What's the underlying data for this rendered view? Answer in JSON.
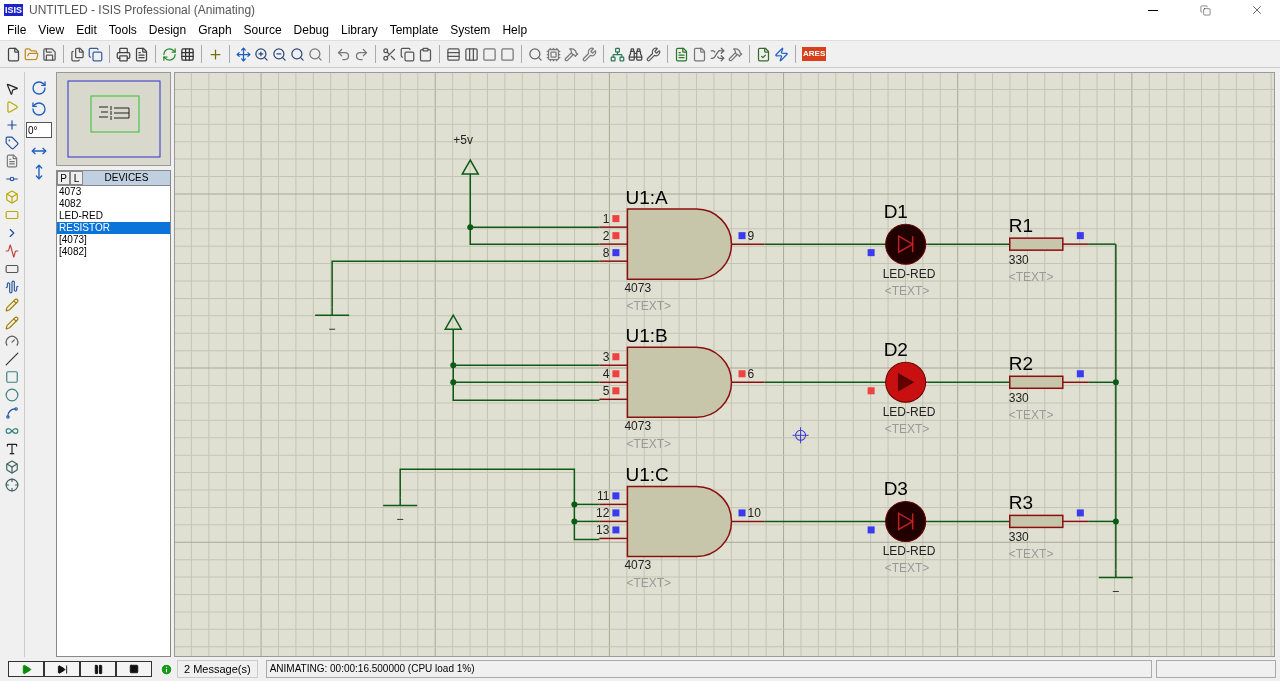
{
  "window": {
    "logo": "ISIS",
    "title": "UNTITLED - ISIS Professional (Animating)"
  },
  "menu": [
    "File",
    "View",
    "Edit",
    "Tools",
    "Design",
    "Graph",
    "Source",
    "Debug",
    "Library",
    "Template",
    "System",
    "Help"
  ],
  "toolbar": {
    "ares_label": "ARES"
  },
  "rotation": {
    "value": "0°"
  },
  "devices": {
    "tabs": [
      "P",
      "L"
    ],
    "header": "DEVICES",
    "items": [
      {
        "label": "4073",
        "selected": false
      },
      {
        "label": "4082",
        "selected": false
      },
      {
        "label": "LED-RED",
        "selected": false
      },
      {
        "label": "RESISTOR",
        "selected": true
      },
      {
        "label": "[4073]",
        "selected": false
      },
      {
        "label": "[4082]",
        "selected": false
      }
    ]
  },
  "schematic": {
    "power_label": "+5v",
    "gates": [
      {
        "label": "U1:A",
        "part": "4073",
        "text": "<TEXT>",
        "inputs": [
          {
            "pin": "1",
            "high": true
          },
          {
            "pin": "2",
            "high": true
          },
          {
            "pin": "8",
            "high": false
          }
        ],
        "output": {
          "pin": "9",
          "high": false
        }
      },
      {
        "label": "U1:B",
        "part": "4073",
        "text": "<TEXT>",
        "inputs": [
          {
            "pin": "3",
            "high": true
          },
          {
            "pin": "4",
            "high": true
          },
          {
            "pin": "5",
            "high": true
          }
        ],
        "output": {
          "pin": "6",
          "high": true
        }
      },
      {
        "label": "U1:C",
        "part": "4073",
        "text": "<TEXT>",
        "inputs": [
          {
            "pin": "11",
            "high": false
          },
          {
            "pin": "12",
            "high": false
          },
          {
            "pin": "13",
            "high": false
          }
        ],
        "output": {
          "pin": "10",
          "high": false
        }
      }
    ],
    "leds": [
      {
        "label": "D1",
        "part": "LED-RED",
        "text": "<TEXT>",
        "lit": false,
        "pin_high": false
      },
      {
        "label": "D2",
        "part": "LED-RED",
        "text": "<TEXT>",
        "lit": true,
        "pin_high": true
      },
      {
        "label": "D3",
        "part": "LED-RED",
        "text": "<TEXT>",
        "lit": false,
        "pin_high": false
      }
    ],
    "resistors": [
      {
        "label": "R1",
        "value": "330",
        "text": "<TEXT>",
        "pin_high": false
      },
      {
        "label": "R2",
        "value": "330",
        "text": "<TEXT>",
        "pin_high": false
      },
      {
        "label": "R3",
        "value": "330",
        "text": "<TEXT>",
        "pin_high": false
      }
    ]
  },
  "status_bar": {
    "messages": "2 Message(s)",
    "status": "ANIMATING: 00:00:16.500000 (CPU load 1%)"
  }
}
